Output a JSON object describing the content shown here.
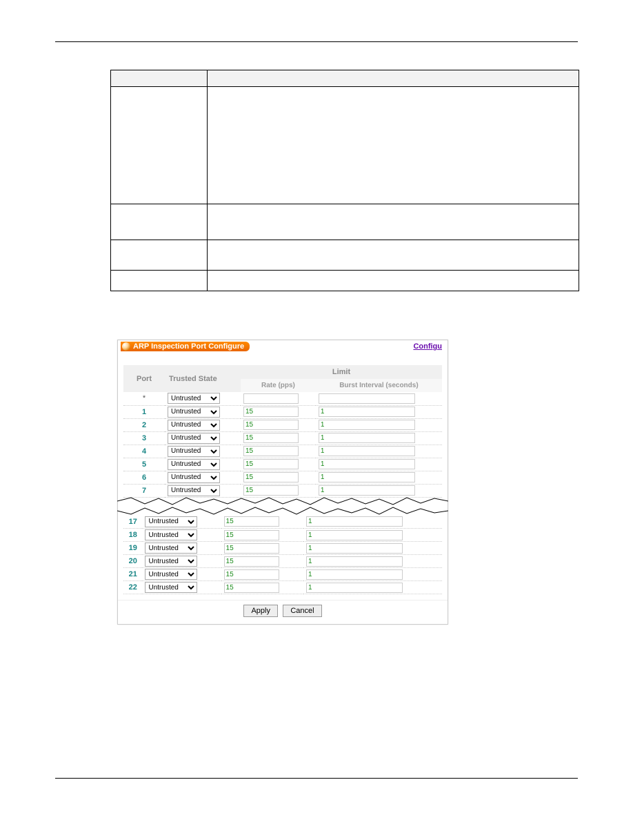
{
  "desc_table": {
    "headers": [
      "",
      ""
    ],
    "rows": [
      {
        "label": "",
        "desc": ""
      },
      {
        "label": "",
        "desc": ""
      },
      {
        "label": "",
        "desc": ""
      },
      {
        "label": "",
        "desc": ""
      }
    ]
  },
  "panel": {
    "title": "ARP Inspection Port Configure",
    "configu": "Configu",
    "headers": {
      "port": "Port",
      "trusted_state": "Trusted State",
      "limit": "Limit",
      "rate": "Rate (pps)",
      "burst": "Burst Interval (seconds)"
    },
    "trusted_option": "Untrusted",
    "rows_top": [
      {
        "port": "*",
        "rate": "",
        "burst": ""
      },
      {
        "port": "1",
        "rate": "15",
        "burst": "1"
      },
      {
        "port": "2",
        "rate": "15",
        "burst": "1"
      },
      {
        "port": "3",
        "rate": "15",
        "burst": "1"
      },
      {
        "port": "4",
        "rate": "15",
        "burst": "1"
      },
      {
        "port": "5",
        "rate": "15",
        "burst": "1"
      },
      {
        "port": "6",
        "rate": "15",
        "burst": "1"
      },
      {
        "port": "7",
        "rate": "15",
        "burst": "1"
      }
    ],
    "rows_bottom": [
      {
        "port": "17",
        "rate": "15",
        "burst": "1"
      },
      {
        "port": "18",
        "rate": "15",
        "burst": "1"
      },
      {
        "port": "19",
        "rate": "15",
        "burst": "1"
      },
      {
        "port": "20",
        "rate": "15",
        "burst": "1"
      },
      {
        "port": "21",
        "rate": "15",
        "burst": "1"
      },
      {
        "port": "22",
        "rate": "15",
        "burst": "1"
      }
    ],
    "buttons": {
      "apply": "Apply",
      "cancel": "Cancel"
    }
  }
}
